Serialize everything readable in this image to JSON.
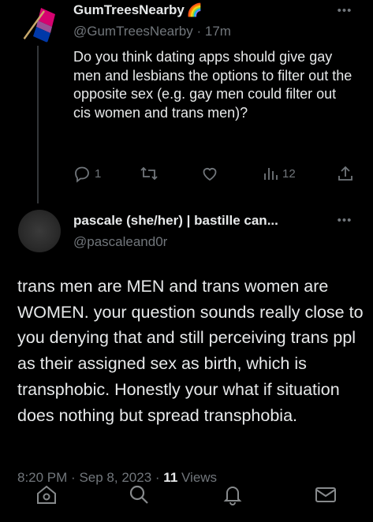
{
  "tweet": {
    "author_name": "GumTreesNearby",
    "author_emoji": "🌈",
    "author_handle": "@GumTreesNearby",
    "separator": "·",
    "time_ago": "17m",
    "text": "Do you think dating apps should give gay men and lesbians the options to filter out the opposite sex (e.g. gay men could filter out cis women and trans men)?",
    "replies": "1",
    "views": "12",
    "avatar_colors": [
      "#d60270",
      "#9b4f96",
      "#0038a8"
    ]
  },
  "reply": {
    "author_name": "pascale (she/her) | bastille can...",
    "author_handle": "@pascaleand0r",
    "text": "trans men are MEN and trans women are WOMEN. your question sounds really close to you denying that and still perceiving trans ppl as their assigned sex as birth, which is transphobic. Honestly your what if situation does nothing but spread transphobia.",
    "time": "8:20 PM",
    "separator": "·",
    "date": "Sep 8, 2023",
    "views_count": "11",
    "views_label": "Views"
  },
  "icons": {
    "more": "more-icon",
    "reply": "reply-icon",
    "retweet": "retweet-icon",
    "like": "heart-icon",
    "views": "views-icon",
    "share": "share-icon",
    "tab_home": "home-icon",
    "tab_search": "search-icon",
    "tab_notifications": "bell-icon",
    "tab_messages": "mail-icon"
  },
  "colors": {
    "background": "#000000",
    "text": "#e7e9ea",
    "secondary": "#71767b",
    "divider": "#333639"
  }
}
